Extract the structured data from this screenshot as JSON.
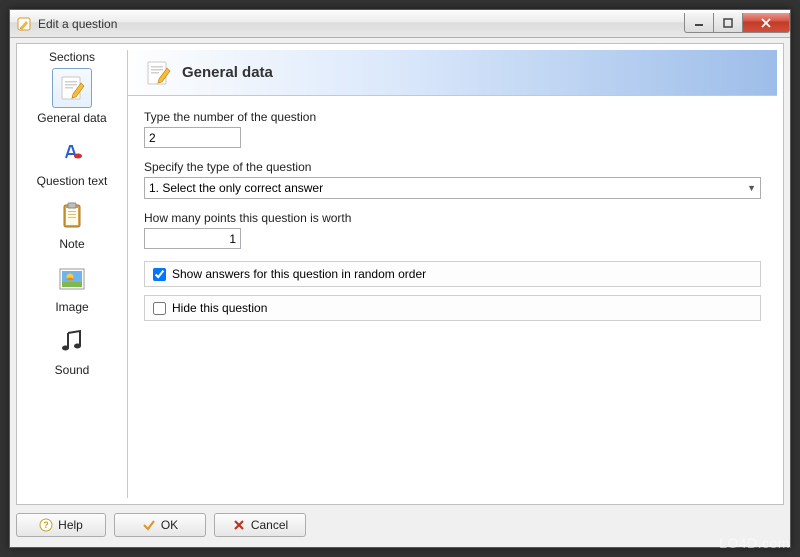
{
  "window": {
    "title": "Edit a question"
  },
  "sidebar": {
    "title": "Sections",
    "items": [
      {
        "label": "General data",
        "selected": true
      },
      {
        "label": "Question text"
      },
      {
        "label": "Note"
      },
      {
        "label": "Image"
      },
      {
        "label": "Sound"
      }
    ]
  },
  "main": {
    "title": "General data",
    "fields": {
      "number": {
        "label": "Type the number of the question",
        "value": "2"
      },
      "type": {
        "label": "Specify the type of the question",
        "value": "1. Select the only correct answer"
      },
      "points": {
        "label": "How many points this question is worth",
        "value": "1"
      }
    },
    "checkboxes": {
      "random": {
        "label": "Show answers for this question in random order",
        "checked": true
      },
      "hide": {
        "label": "Hide this question",
        "checked": false
      }
    }
  },
  "footer": {
    "help": "Help",
    "ok": "OK",
    "cancel": "Cancel"
  },
  "watermark": "LO4D.com"
}
